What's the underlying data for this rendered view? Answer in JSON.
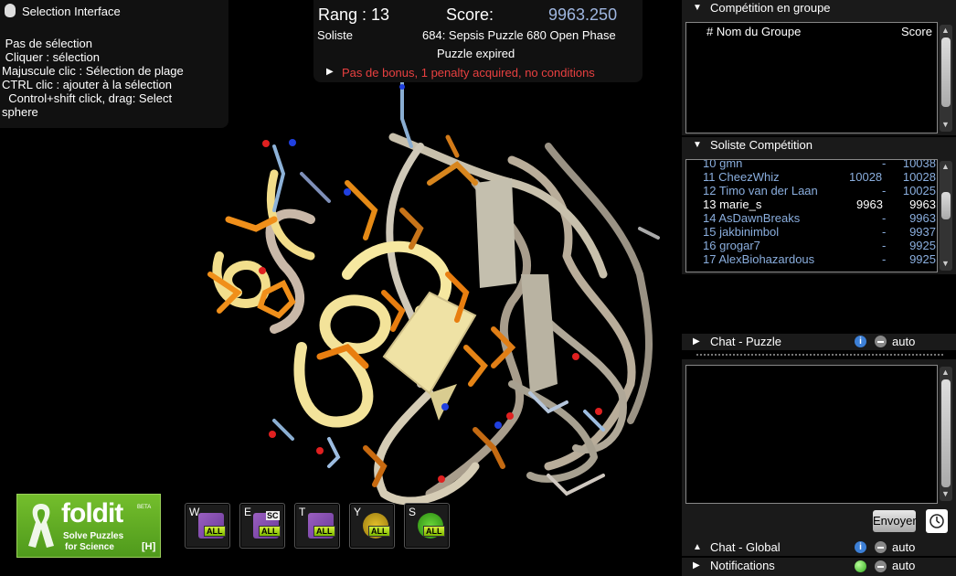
{
  "selection": {
    "title": "Selection Interface",
    "lines": [
      " Pas de sélection",
      " Cliquer : sélection",
      "Majuscule clic : Sélection de plage",
      "CTRL clic : ajouter à la sélection",
      "  Control+shift click, drag: Select",
      "sphere"
    ]
  },
  "score": {
    "rank": "Rang : 13",
    "score_label": "Score:",
    "score_value": "9963.250",
    "mode": "Soliste",
    "puzzle": "684: Sepsis Puzzle 680 Open Phase",
    "status": "Puzzle expired",
    "bonus": "Pas de bonus, 1 penalty acquired, no conditions"
  },
  "group": {
    "header": "Compétition en groupe",
    "col_name": "# Nom du Groupe",
    "col_score": "Score"
  },
  "solo": {
    "header": "Soliste Compétition",
    "rows": [
      {
        "rank": "10",
        "name": "gmn",
        "own": "-",
        "score": "10038"
      },
      {
        "rank": "11",
        "name": "CheezWhiz",
        "own": "10028",
        "score": "10028"
      },
      {
        "rank": "12",
        "name": "Timo van der Laan",
        "own": "-",
        "score": "10025"
      },
      {
        "rank": "13",
        "name": "marie_s",
        "own": "9963",
        "score": "9963"
      },
      {
        "rank": "14",
        "name": "AsDawnBreaks",
        "own": "-",
        "score": "9963"
      },
      {
        "rank": "15",
        "name": "jakbinimbol",
        "own": "-",
        "score": "9937"
      },
      {
        "rank": "16",
        "name": "grogar7",
        "own": "-",
        "score": "9925"
      },
      {
        "rank": "17",
        "name": "AlexBiohazardous",
        "own": "-",
        "score": "9925"
      }
    ]
  },
  "chat_puzzle": {
    "header": "Chat - Puzzle",
    "auto": "auto",
    "send": "Envoyer"
  },
  "chat_global": {
    "header": "Chat - Global",
    "auto": "auto"
  },
  "notifications": {
    "header": "Notifications",
    "auto": "auto"
  },
  "toolbar": [
    {
      "key": "W",
      "badge": "ALL"
    },
    {
      "key": "E",
      "badge": "ALL",
      "sub": "SC"
    },
    {
      "key": "T",
      "badge": "ALL"
    },
    {
      "key": "Y",
      "badge": "ALL"
    },
    {
      "key": "S",
      "badge": "ALL"
    }
  ],
  "logo": {
    "brand": "foldit",
    "beta": "BETA",
    "tag1": "Solve Puzzles",
    "tag2": "for Science",
    "hotkey": "[H]"
  },
  "colors": {
    "accent": "#9fb6e0",
    "warning": "#e84040",
    "brand_green": "#6ab22a"
  }
}
